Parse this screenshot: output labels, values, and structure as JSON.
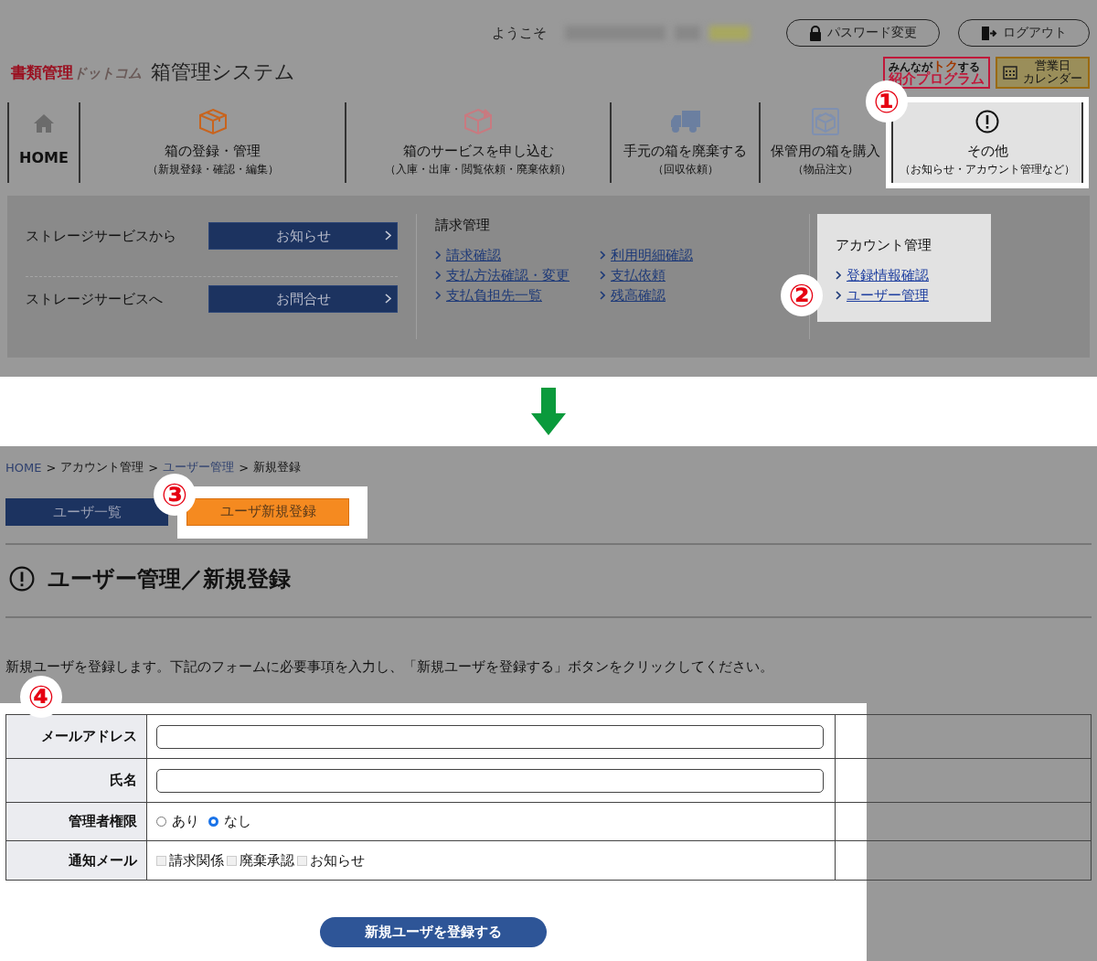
{
  "header": {
    "welcome": "ようこそ",
    "buttons": [
      {
        "kind": "password",
        "label": "パスワード変更"
      },
      {
        "kind": "logout",
        "label": "ログアウト"
      }
    ],
    "logo": {
      "mark": "書類管理",
      "suffix": "ドットコム",
      "title": "箱管理システム"
    },
    "referral": {
      "top": "みんなが",
      "highlight": "トク",
      "after": "する",
      "main": "紹介プログラム"
    },
    "calendar": [
      "営業日",
      "カレンダー"
    ]
  },
  "nav": {
    "step": "①",
    "items": [
      {
        "kind": "home",
        "label": "HOME",
        "selected": false
      },
      {
        "kind": "box",
        "label": "箱の登録・管理",
        "sub": "（新規登録・確認・編集）",
        "selected": false
      },
      {
        "kind": "box-up",
        "label": "箱のサービスを申し込む",
        "sub": "（入庫・出庫・閲覧依頼・廃棄依頼）",
        "selected": false
      },
      {
        "kind": "truck",
        "label": "手元の箱を廃棄する",
        "sub": "（回収依頼）",
        "selected": false
      },
      {
        "kind": "box-open",
        "label": "保管用の箱を購入",
        "sub": "（物品注文）",
        "selected": false
      },
      {
        "kind": "notice",
        "label": "その他",
        "sub": "（お知らせ・アカウント管理など）",
        "selected": true
      }
    ]
  },
  "mega_menu": {
    "storage": [
      {
        "label": "ストレージサービスから",
        "button": "お知らせ"
      },
      {
        "label": "ストレージサービスへ",
        "button": "お問合せ"
      }
    ],
    "billing": {
      "title": "請求管理",
      "links": [
        "請求確認",
        "支払方法確認・変更",
        "支払負担先一覧",
        "利用明細確認",
        "支払依頼",
        "残高確認"
      ]
    },
    "account": {
      "title": "アカウント管理",
      "links": [
        "登録情報確認",
        "ユーザー管理"
      ],
      "step": "②"
    }
  },
  "page": {
    "breadcrumb": [
      {
        "label": "HOME",
        "link": true
      },
      {
        "label": "アカウント管理",
        "link": false
      },
      {
        "label": "ユーザー管理",
        "link": true
      },
      {
        "label": "新規登録",
        "link": false
      }
    ],
    "separator": ">",
    "tabs_step": "③",
    "tabs": [
      {
        "label": "ユーザ一覧",
        "selected": false
      },
      {
        "label": "ユーザ新規登録",
        "selected": true
      }
    ],
    "title": "ユーザー管理／新規登録",
    "intro": "新規ユーザを登録します。下記のフォームに必要事項を入力し、「新規ユーザを登録する」ボタンをクリックしてください。",
    "form": {
      "step": "④",
      "rows": [
        {
          "kind": "text",
          "label": "メールアドレス"
        },
        {
          "kind": "text",
          "label": "氏名"
        },
        {
          "kind": "radio",
          "label": "管理者権限",
          "options": [
            {
              "label": "あり",
              "selected": false
            },
            {
              "label": "なし",
              "selected": true
            }
          ]
        },
        {
          "kind": "checkbox",
          "label": "通知メール",
          "options": [
            {
              "label": "請求関係",
              "checked": false
            },
            {
              "label": "廃棄承認",
              "checked": false
            },
            {
              "label": "お知らせ",
              "checked": false
            }
          ]
        }
      ],
      "submit": "新規ユーザを登録する"
    }
  }
}
